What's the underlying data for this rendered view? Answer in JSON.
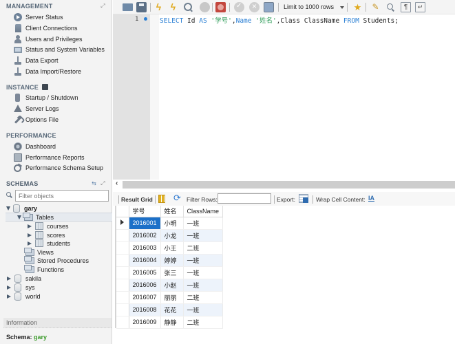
{
  "sidebar": {
    "management": {
      "title": "MANAGEMENT",
      "items": [
        {
          "label": "Server Status",
          "icon": "play-circle-icon"
        },
        {
          "label": "Client Connections",
          "icon": "server-connection-icon"
        },
        {
          "label": "Users and Privileges",
          "icon": "user-icon"
        },
        {
          "label": "Status and System Variables",
          "icon": "monitor-icon"
        },
        {
          "label": "Data Export",
          "icon": "export-icon"
        },
        {
          "label": "Data Import/Restore",
          "icon": "import-icon"
        }
      ]
    },
    "instance": {
      "title": "INSTANCE",
      "items": [
        {
          "label": "Startup / Shutdown",
          "icon": "power-icon"
        },
        {
          "label": "Server Logs",
          "icon": "warning-icon"
        },
        {
          "label": "Options File",
          "icon": "wrench-icon"
        }
      ]
    },
    "performance": {
      "title": "PERFORMANCE",
      "items": [
        {
          "label": "Dashboard",
          "icon": "dashboard-icon"
        },
        {
          "label": "Performance Reports",
          "icon": "report-icon"
        },
        {
          "label": "Performance Schema Setup",
          "icon": "setup-icon"
        }
      ]
    },
    "schemas": {
      "title": "SCHEMAS",
      "filter_placeholder": "Filter objects",
      "tree": {
        "gary": "gary",
        "tables": "Tables",
        "table_items": [
          "courses",
          "scores",
          "students"
        ],
        "views": "Views",
        "stored_procedures": "Stored Procedures",
        "functions": "Functions",
        "other_schemas": [
          "sakila",
          "sys",
          "world"
        ]
      }
    },
    "information": {
      "title": "Information",
      "schema_label": "Schema:",
      "schema_value": "gary"
    }
  },
  "toolbar": {
    "limit_label": "Limit to 1000 rows"
  },
  "editor": {
    "line_number": "1",
    "tokens": [
      {
        "t": "SELECT",
        "c": "kw"
      },
      {
        "t": " Id ",
        "c": ""
      },
      {
        "t": "AS",
        "c": "kw"
      },
      {
        "t": " ",
        "c": ""
      },
      {
        "t": "'学号'",
        "c": "str"
      },
      {
        "t": ",",
        "c": ""
      },
      {
        "t": "Name",
        "c": "kw"
      },
      {
        "t": " ",
        "c": ""
      },
      {
        "t": "'姓名'",
        "c": "str"
      },
      {
        "t": ",Class ClassName ",
        "c": ""
      },
      {
        "t": "FROM",
        "c": "kw"
      },
      {
        "t": " Students;",
        "c": ""
      }
    ]
  },
  "results": {
    "result_grid_label": "Result Grid",
    "filter_rows_label": "Filter Rows:",
    "filter_rows_value": "",
    "export_label": "Export:",
    "wrap_label": "Wrap Cell Content:",
    "columns": [
      "学号",
      "姓名",
      "ClassName"
    ],
    "rows": [
      [
        "2016001",
        "小明",
        "一班"
      ],
      [
        "2016002",
        "小龙",
        "一班"
      ],
      [
        "2016003",
        "小王",
        "二班"
      ],
      [
        "2016004",
        "婷婷",
        "一班"
      ],
      [
        "2016005",
        "张三",
        "一班"
      ],
      [
        "2016006",
        "小赵",
        "一班"
      ],
      [
        "2016007",
        "丽丽",
        "二班"
      ],
      [
        "2016008",
        "花花",
        "一班"
      ],
      [
        "2016009",
        "静静",
        "二班"
      ]
    ],
    "selected_row": 0
  }
}
